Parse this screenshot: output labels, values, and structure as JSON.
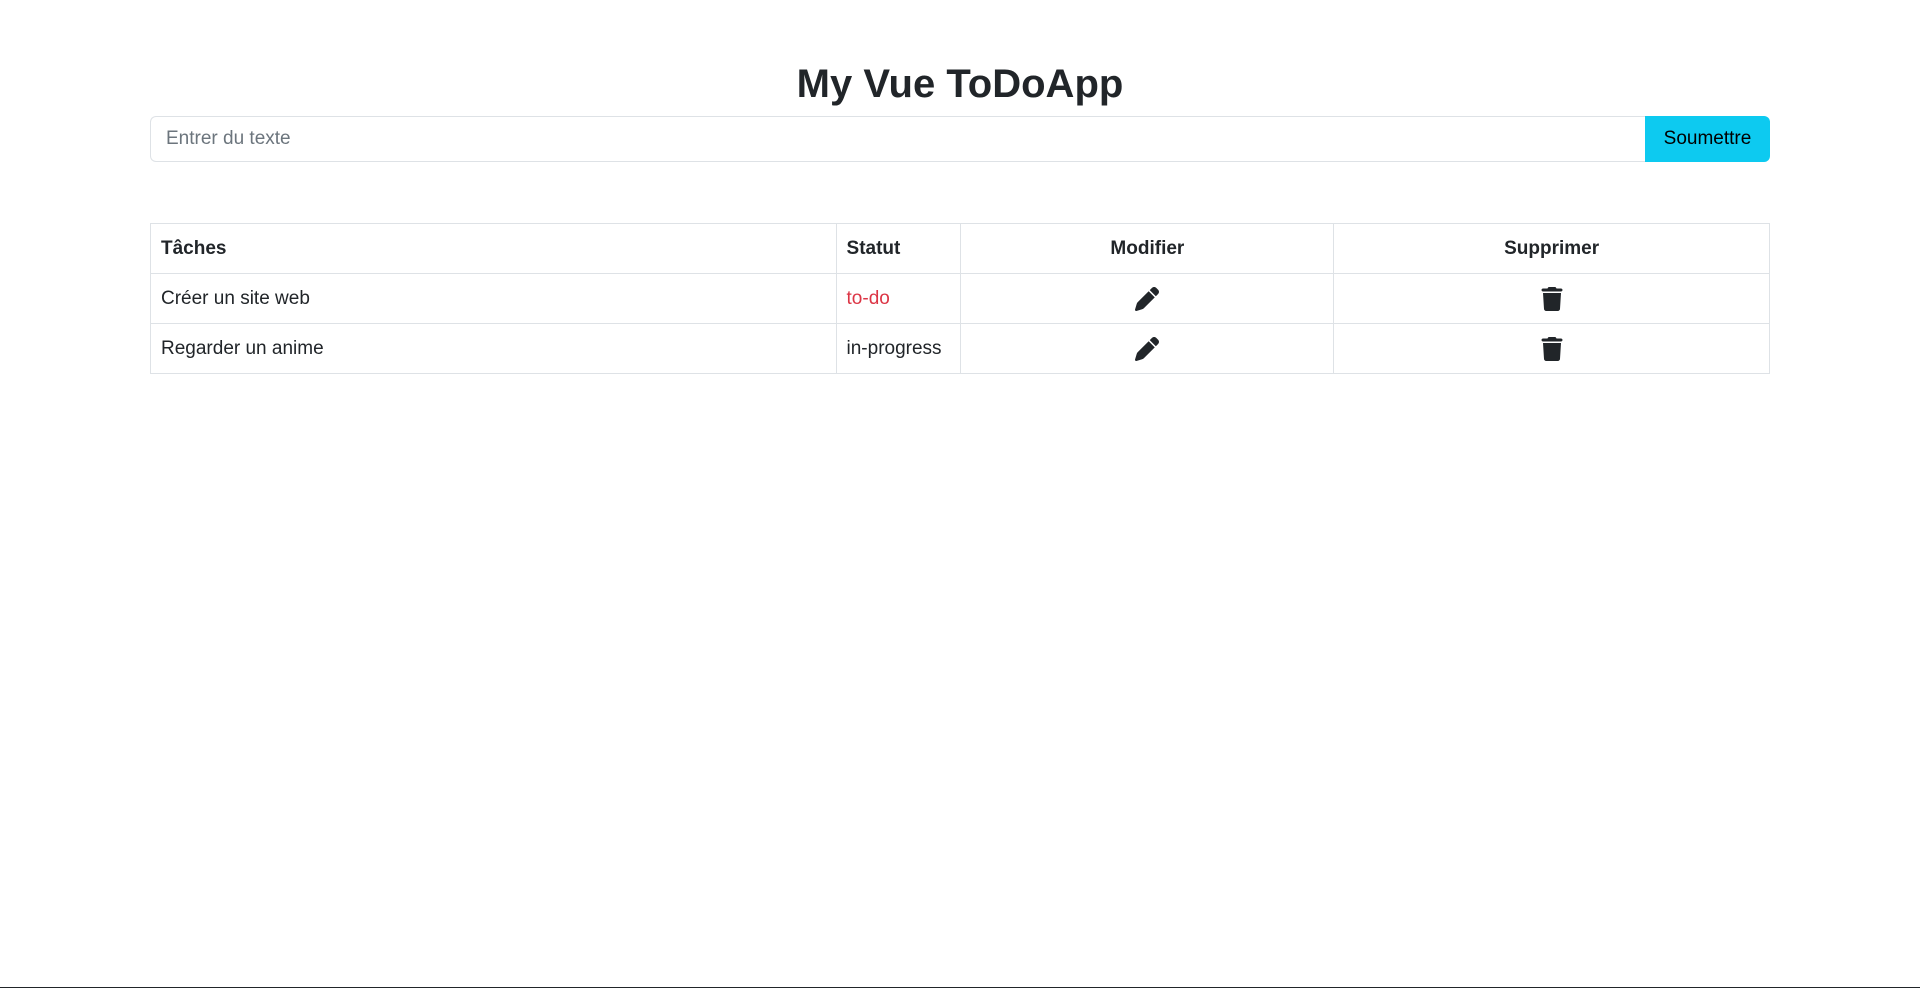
{
  "app": {
    "title": "My Vue ToDoApp"
  },
  "form": {
    "placeholder": "Entrer du texte",
    "value": "",
    "submit_label": "Soumettre",
    "submit_color": "#0dcaf0"
  },
  "table": {
    "headers": {
      "task": "Tâches",
      "status": "Statut",
      "edit": "Modifier",
      "delete": "Supprimer"
    },
    "rows": [
      {
        "task": "Créer un site web",
        "status": "to-do",
        "status_color": "#dc3545",
        "edit_icon": "pencil-icon",
        "delete_icon": "trash-icon"
      },
      {
        "task": "Regarder un anime",
        "status": "in-progress",
        "status_color": "#212529",
        "edit_icon": "pencil-icon",
        "delete_icon": "trash-icon"
      }
    ]
  }
}
